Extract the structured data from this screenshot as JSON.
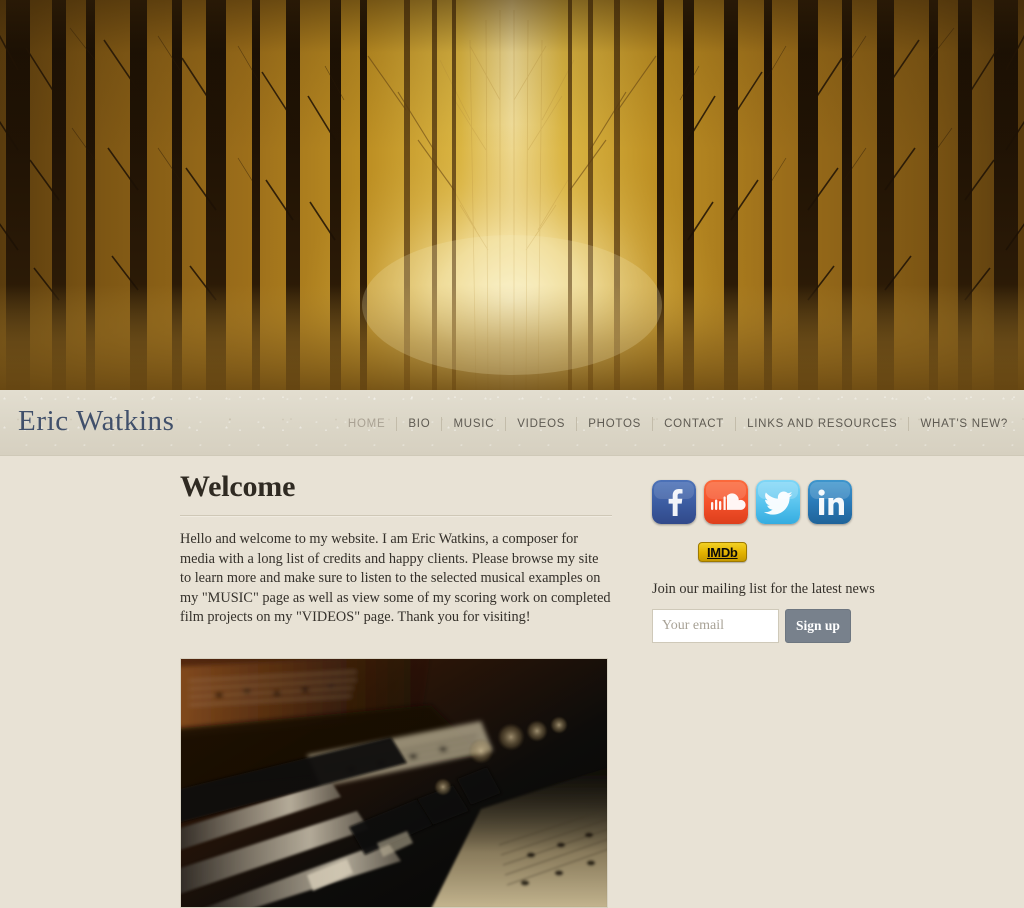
{
  "site": {
    "title": "Eric Watkins"
  },
  "hero": {
    "alt": "Sepia forest of bare trees with glowing light down the center"
  },
  "nav": {
    "items": [
      {
        "label": "HOME",
        "active": true
      },
      {
        "label": "BIO",
        "active": false
      },
      {
        "label": "MUSIC",
        "active": false
      },
      {
        "label": "VIDEOS",
        "active": false
      },
      {
        "label": "PHOTOS",
        "active": false
      },
      {
        "label": "CONTACT",
        "active": false
      },
      {
        "label": "LINKS AND RESOURCES",
        "active": false
      },
      {
        "label": "WHAT'S NEW?",
        "active": false
      }
    ]
  },
  "main": {
    "heading": "Welcome",
    "paragraph": "Hello and welcome to my website.  I am Eric Watkins, a composer for media with a long list of credits and happy clients.  Please browse my site to learn more and make sure to listen to the selected musical examples on my \"MUSIC\" page as well as view some of my scoring work on completed film projects on my \"VIDEOS\" page. Thank you for visiting!",
    "photo_alt": "Close-up of piano keys with sheet music in low light"
  },
  "sidebar": {
    "social": [
      {
        "name": "facebook",
        "label": "Facebook",
        "color": "#3b5ba0"
      },
      {
        "name": "soundcloud",
        "label": "SoundCloud",
        "color": "#f4502a"
      },
      {
        "name": "twitter",
        "label": "Twitter",
        "color": "#5bc5ef"
      },
      {
        "name": "linkedin",
        "label": "LinkedIn",
        "color": "#2b7bb9"
      }
    ],
    "imdb_label": "IMDb",
    "mailing": {
      "label": "Join our mailing list for the latest news",
      "email_placeholder": "Your email",
      "email_value": "",
      "signup_label": "Sign up"
    }
  },
  "colors": {
    "page_background": "#e8e2d5",
    "header_band": "#dcd7c8",
    "title_text": "#41506b",
    "nav_text": "#5e5a52",
    "nav_active_text": "#a9a193",
    "heading_text": "#2f2a22",
    "body_text": "#34302a",
    "signup_button": "#78818c",
    "imdb_gold": "#e2b200"
  }
}
